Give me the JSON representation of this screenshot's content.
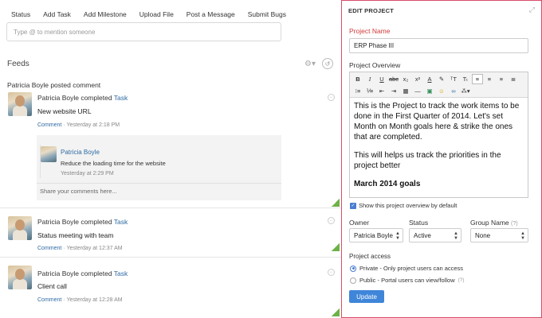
{
  "post_tabs": [
    "Status",
    "Add Task",
    "Add Milestone",
    "Upload File",
    "Post a Message",
    "Submit Bugs"
  ],
  "mention_placeholder": "Type @ to mention someone",
  "feeds_title": "Feeds",
  "posted_by": "Patricia Boyle posted comment",
  "feeds": [
    {
      "actor": "Patricia Boyle completed",
      "task_link": "Task",
      "title": "New website URL",
      "comment_link": "Comment",
      "time": "· Yesterday at 2:18 PM",
      "comments": [
        {
          "author": "Patricia Boyle",
          "text": "Reduce the loading time for the website",
          "time": "Yesterday at 2:29 PM"
        }
      ],
      "share_placeholder": "Share your comments here..."
    },
    {
      "actor": "Patricia Boyle completed",
      "task_link": "Task",
      "title": "Status meeting with team",
      "comment_link": "Comment",
      "time": "· Yesterday at 12:37 AM"
    },
    {
      "actor": "Patricia Boyle completed",
      "task_link": "Task",
      "title": "Client call",
      "comment_link": "Comment",
      "time": "· Yesterday at 12:28 AM"
    }
  ],
  "panel": {
    "heading": "EDIT PROJECT",
    "project_name_label": "Project Name",
    "project_name_value": "ERP Phase III",
    "overview_label": "Project Overview",
    "overview_paragraphs": [
      "This is the Project to track the work items to be done in the First Quarter of 2014. Let's set Month on Month goals here & strike the ones that are completed.",
      "This will helps us track the priorities in the project better"
    ],
    "overview_heading": "March 2014 goals",
    "show_overview_label": "Show this project overview by default",
    "owner_label": "Owner",
    "owner_value": "Patricia Boyle",
    "status_label": "Status",
    "status_value": "Active",
    "group_label": "Group Name",
    "group_help": "(?)",
    "group_value": "None",
    "access_label": "Project access",
    "access_private": "Private - Only project users can access",
    "access_public": "Public - Portal users can view/follow",
    "access_public_help": "(?)",
    "update_label": "Update"
  },
  "colors": {
    "link": "#2e6aa3",
    "panel_border": "#d94b6a",
    "required_label": "#d23a3a",
    "primary_button": "#3f86d9",
    "done_marker": "#6cb247"
  }
}
